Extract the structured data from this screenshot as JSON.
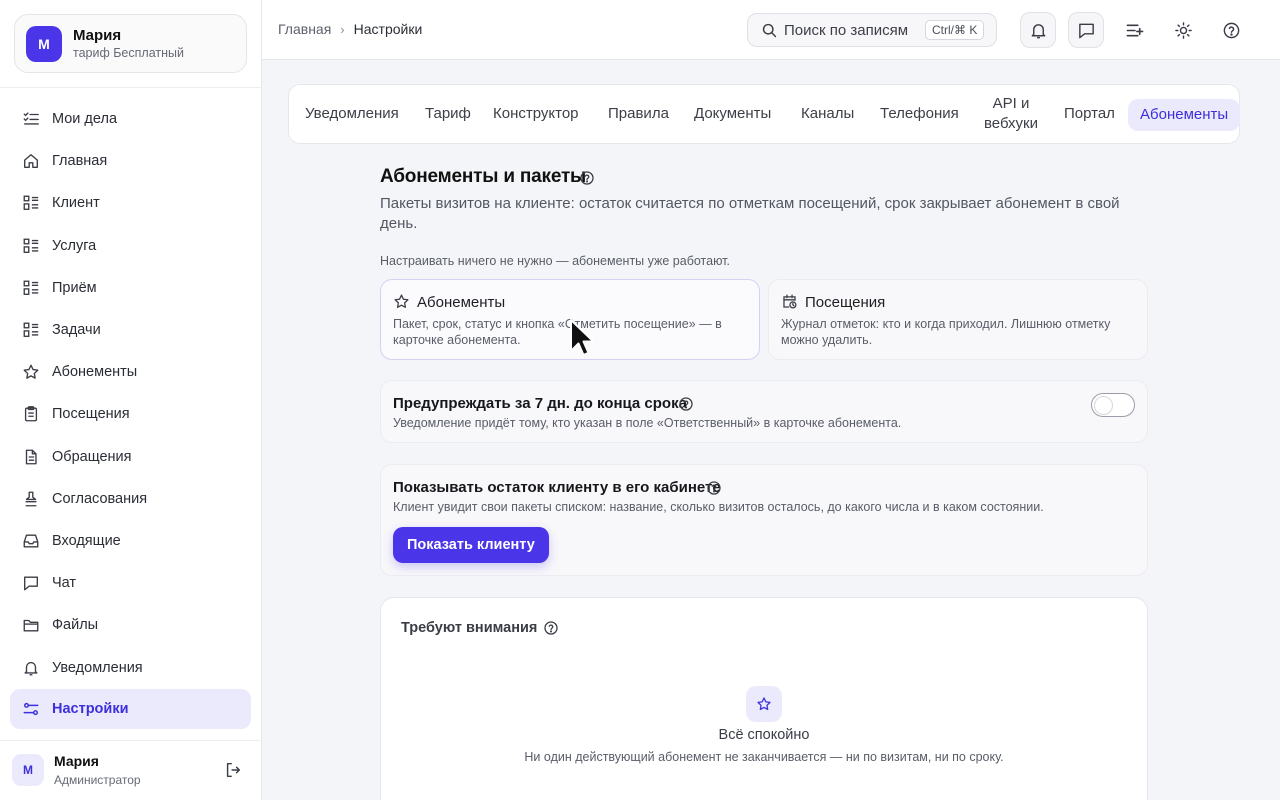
{
  "org": {
    "avatar": "М",
    "name": "Мария",
    "plan": "тариф Бесплатный"
  },
  "sidebar": {
    "items": [
      {
        "label": "Мои дела",
        "icon": "task-list-icon"
      },
      {
        "label": "Главная",
        "icon": "home-icon"
      },
      {
        "label": "Клиент",
        "icon": "list-icon"
      },
      {
        "label": "Услуга",
        "icon": "list-icon"
      },
      {
        "label": "Приём",
        "icon": "list-icon"
      },
      {
        "label": "Задачи",
        "icon": "list-icon"
      },
      {
        "label": "Абонементы",
        "icon": "star-icon"
      },
      {
        "label": "Посещения",
        "icon": "clipboard-icon"
      },
      {
        "label": "Обращения",
        "icon": "document-icon"
      },
      {
        "label": "Согласования",
        "icon": "stamp-icon"
      },
      {
        "label": "Входящие",
        "icon": "inbox-icon"
      },
      {
        "label": "Чат",
        "icon": "chat-icon"
      },
      {
        "label": "Файлы",
        "icon": "folder-icon"
      },
      {
        "label": "Уведомления",
        "icon": "bell-icon"
      },
      {
        "label": "Настройки",
        "icon": "settings-sliders-icon",
        "active": true
      }
    ]
  },
  "user": {
    "avatar": "М",
    "name": "Мария",
    "role": "Администратор"
  },
  "breadcrumb": {
    "home": "Главная",
    "separator": "›",
    "current": "Настройки"
  },
  "search": {
    "placeholder": "Поиск по записям",
    "shortcut": "Ctrl/⌘ K"
  },
  "tabs": [
    "Уведомления",
    "Тариф",
    "Конструктор",
    "Правила",
    "Документы",
    "Каналы",
    "Телефония",
    "API и вебхуки",
    "Портал",
    "Абонементы"
  ],
  "active_tab": "Абонементы",
  "page": {
    "title": "Абонементы и пакеты",
    "lead": "Пакеты визитов на клиенте: остаток считается по отметкам посещений, срок закрывает абонемент в свой день.",
    "note": "Настраивать ничего не нужно — абонементы уже работают."
  },
  "tiles": [
    {
      "title": "Абонементы",
      "desc": "Пакет, срок, статус и кнопка «Отметить посещение» — в карточке абонемента.",
      "icon": "star-icon"
    },
    {
      "title": "Посещения",
      "desc": "Журнал отметок: кто и когда приходил. Лишнюю отметку можно удалить.",
      "icon": "calendar-clock-icon"
    }
  ],
  "warn": {
    "title": "Предупреждать за 7 дн. до конца срока",
    "desc": "Уведомление придёт тому, кто указан в поле «Ответственный» в карточке абонемента.",
    "enabled": false
  },
  "show_balance": {
    "title": "Показывать остаток клиенту в его кабинете",
    "desc": "Клиент увидит свои пакеты списком: название, сколько визитов осталось, до какого числа и в каком состоянии.",
    "button": "Показать клиенту"
  },
  "attention": {
    "title": "Требуют внимания",
    "empty_title": "Всё спокойно",
    "empty_desc": "Ни один действующий абонемент не заканчивается — ни по визитам, ни по сроку."
  },
  "colors": {
    "accent": "#4a35e8",
    "accent_soft": "#ebeafd",
    "accent_text": "#3d2fd9"
  }
}
